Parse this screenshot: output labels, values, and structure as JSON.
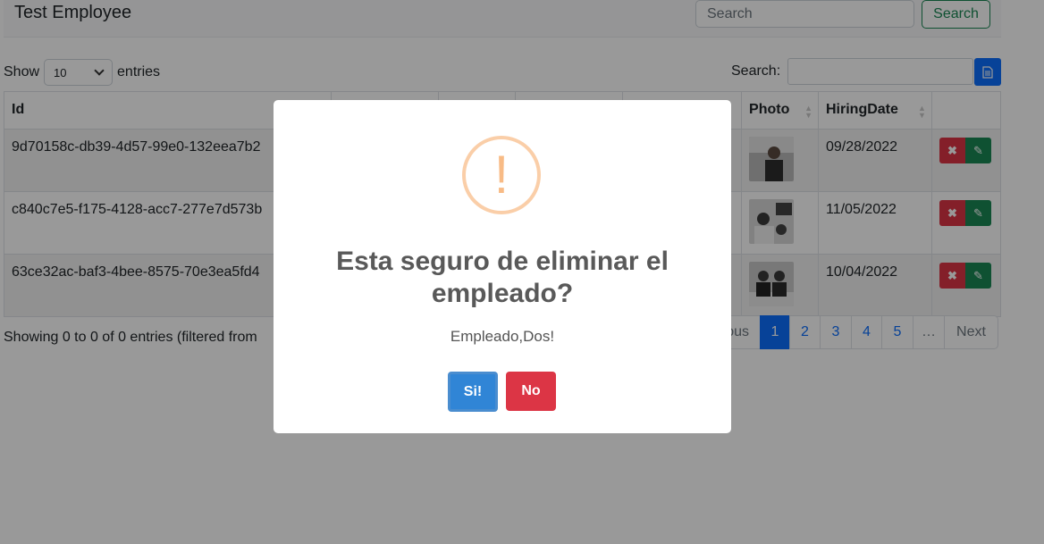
{
  "navbar": {
    "brand": "Test Employee",
    "search_placeholder": "Search",
    "search_button": "Search"
  },
  "controls": {
    "show_label": "Show",
    "page_length": "10",
    "entries_label": "entries",
    "filter_label": "Search:",
    "doc_icon": "document-icon"
  },
  "table": {
    "headers": {
      "id": "Id",
      "photo": "Photo",
      "hiring_date": "HiringDate"
    },
    "rows": [
      {
        "id": "9d70158c-db39-4d57-99e0-132eea7b2",
        "hiring_date": "09/28/2022"
      },
      {
        "id": "c840c7e5-f175-4128-acc7-277e7d573b",
        "hiring_date": "11/05/2022"
      },
      {
        "id": "63ce32ac-baf3-4bee-8575-70e3ea5fd4",
        "hiring_date": "10/04/2022"
      }
    ],
    "delete_icon": "✖",
    "edit_icon": "✎"
  },
  "info": "Showing 0 to 0 of 0 entries (filtered from",
  "pagination": {
    "previous": "ous",
    "pages": [
      "1",
      "2",
      "3",
      "4",
      "5"
    ],
    "ellipsis": "…",
    "next": "Next",
    "active": "1"
  },
  "modal": {
    "icon": "!",
    "title": "Esta seguro de eliminar el empleado?",
    "text": "Empleado,Dos!",
    "confirm": "Si!",
    "cancel": "No"
  }
}
